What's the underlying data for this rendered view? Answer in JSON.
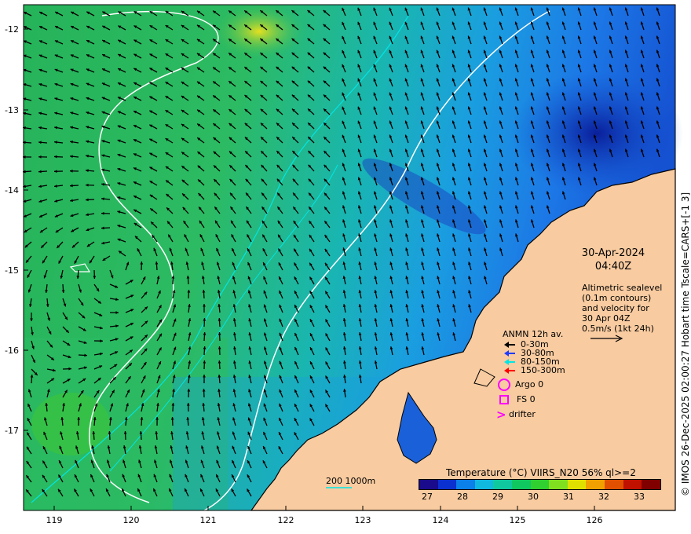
{
  "map": {
    "lon_ticks": [
      "119",
      "120",
      "121",
      "122",
      "123",
      "124",
      "125",
      "126"
    ],
    "lat_ticks": [
      "-12",
      "-13",
      "-14",
      "-15",
      "-16",
      "-17"
    ],
    "colors": {
      "land": "#f8cba0",
      "coast": "#000000",
      "contour": "#ffffff",
      "bathy": "#00e6e6"
    }
  },
  "credit": "© IMOS 26-Dec-2025 02:00:27 Hobart time Tscale=CARS+[-1 3]",
  "date": {
    "line1": "30-Apr-2024",
    "line2": "04:40Z"
  },
  "altimetry": {
    "line1": "Altimetric sealevel",
    "line2": "(0.1m contours)",
    "line3": "and velocity for",
    "line4": "30 Apr 04Z",
    "line5": "0.5m/s (1kt 24h)"
  },
  "legend": {
    "title": "ANMN 12h av.",
    "items": [
      {
        "label": "0-30m",
        "color": "#000000"
      },
      {
        "label": "30-80m",
        "color": "#1e3cff"
      },
      {
        "label": "80-150m",
        "color": "#00e6e6"
      },
      {
        "label": "150-300m",
        "color": "#ff0000"
      }
    ]
  },
  "markers": [
    {
      "label": "Argo 0",
      "icon": "circle-marker-icon",
      "color": "#ff00ff"
    },
    {
      "label": "FS 0",
      "icon": "square-marker-icon",
      "color": "#ff00ff"
    },
    {
      "label": "drifter",
      "icon": "chevron-marker-icon",
      "color": "#ff00ff"
    }
  ],
  "colorbar": {
    "title": "Temperature (°C) VIIRS_N20 56% ql>=2",
    "ticks": [
      "27",
      "28",
      "29",
      "30",
      "31",
      "32",
      "33"
    ],
    "colors": [
      "#1a0a8c",
      "#0a30d0",
      "#0a80e8",
      "#10b8e0",
      "#10c8a0",
      "#10c860",
      "#30d030",
      "#80e020",
      "#e0e000",
      "#f0a000",
      "#e05000",
      "#c01000",
      "#800000"
    ]
  },
  "scale": {
    "label": "200  1000m"
  }
}
